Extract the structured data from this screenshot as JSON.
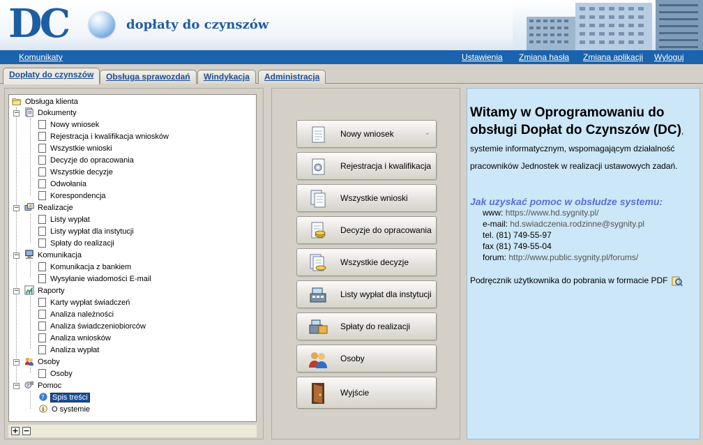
{
  "header": {
    "logo": "DC",
    "title": "dopłaty do czynszów"
  },
  "navbar": {
    "left": "Komunikaty",
    "right": [
      "Ustawienia",
      "Zmiana hasła",
      "Zmiana aplikacji",
      "Wyloguj"
    ]
  },
  "tabs": [
    "Dopłaty do czynszów",
    "Obsługa sprawozdań",
    "Windykacja",
    "Administracja"
  ],
  "tree": {
    "root": "Obsługa klienta",
    "groups": [
      {
        "label": "Dokumenty",
        "icon": "document-icon",
        "items": [
          "Nowy wniosek",
          "Rejestracja i kwalifikacja wniosków",
          "Wszystkie wnioski",
          "Decyzje do opracowania",
          "Wszystkie decyzje",
          "Odwołania",
          "Korespondencja"
        ]
      },
      {
        "label": "Realizacje",
        "icon": "payments-icon",
        "items": [
          "Listy wypłat",
          "Listy wypłat dla instytucji",
          "Spłaty do realizacji"
        ]
      },
      {
        "label": "Komunikacja",
        "icon": "computer-icon",
        "items": [
          "Komunikacja z bankiem",
          "Wysyłanie wiadomości E-mail"
        ]
      },
      {
        "label": "Raporty",
        "icon": "chart-icon",
        "items": [
          "Karty wypłat świadczeń",
          "Analiza należności",
          "Analiza świadczeniobiorców",
          "Analiza wniosków",
          "Analiza wypłat"
        ]
      },
      {
        "label": "Osoby",
        "icon": "people-icon",
        "items": [
          "Osoby"
        ]
      },
      {
        "label": "Pomoc",
        "icon": "help-icon",
        "items": [
          "Spis treści",
          "O systemie"
        ]
      }
    ],
    "expand_all": "+",
    "collapse_all": "−"
  },
  "buttons": [
    {
      "label": "Nowy wniosek",
      "icon": "new-document-icon"
    },
    {
      "label": "Rejestracja i kwalifikacja",
      "icon": "gear-document-icon"
    },
    {
      "label": "Wszystkie wnioski",
      "icon": "documents-icon"
    },
    {
      "label": "Decyzje do opracowania",
      "icon": "coins-document-icon"
    },
    {
      "label": "Wszystkie decyzje",
      "icon": "decisions-icon"
    },
    {
      "label": "Listy wypłat dla instytucji",
      "icon": "cash-register-icon"
    },
    {
      "label": "Spłaty do realizacji",
      "icon": "cash-folder-icon"
    },
    {
      "label": "Osoby",
      "icon": "people-icon"
    },
    {
      "label": "Wyjście",
      "icon": "exit-door-icon"
    }
  ],
  "welcome": {
    "heading": "Witamy w Oprogramowaniu do obsługi Dopłat do Czynszów (DC)",
    "rest": ", systemie informatycznym, wspomagającym działalność pracowników Jednostek w realizacji ustawowych zadań.",
    "help_heading": "Jak uzyskać pomoc w obsłudze systemu:",
    "contacts": [
      {
        "label": "www:",
        "value": "https://www.hd.sygnity.pl/"
      },
      {
        "label": "e-mail:",
        "value": "hd.swiadczenia.rodzinne@sygnity.pl"
      },
      {
        "label": "tel.",
        "value": "(81) 749-55-97"
      },
      {
        "label": "fax",
        "value": "(81) 749-55-04"
      },
      {
        "label": "forum:",
        "value": "http://www.public.sygnity.pl/forums/"
      }
    ],
    "manual": "Podręcznik użytkownika do pobrania w formacie PDF"
  },
  "colors": {
    "accent": "#1b63ad",
    "logo": "#1f5da2",
    "help_heading": "#5b6fd0",
    "info_panel": "#cce7f8"
  }
}
